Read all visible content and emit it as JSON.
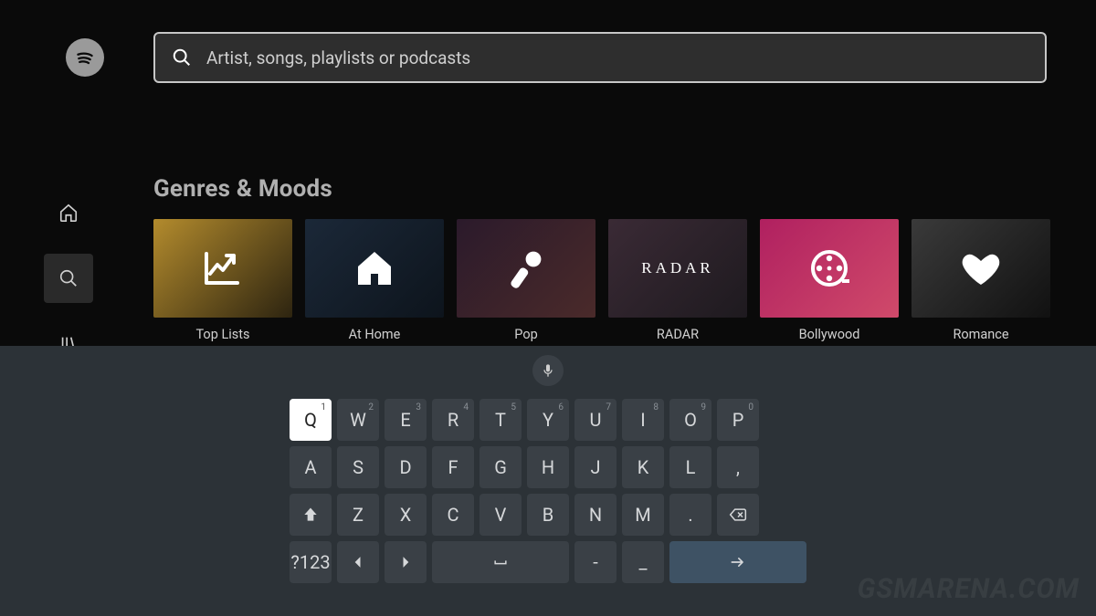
{
  "search": {
    "placeholder": "Artist, songs, playlists or podcasts"
  },
  "section_title": "Genres & Moods",
  "tiles": [
    {
      "label": "Top Lists",
      "icon": "chart-up-icon"
    },
    {
      "label": "At Home",
      "icon": "home-icon"
    },
    {
      "label": "Pop",
      "icon": "microphone-icon"
    },
    {
      "label": "RADAR",
      "icon": "radar-text",
      "overlay": "RADAR"
    },
    {
      "label": "Bollywood",
      "icon": "film-reel-icon"
    },
    {
      "label": "Romance",
      "icon": "heart-icon"
    }
  ],
  "keyboard": {
    "row1": [
      {
        "k": "Q",
        "sup": "1",
        "sel": true
      },
      {
        "k": "W",
        "sup": "2"
      },
      {
        "k": "E",
        "sup": "3"
      },
      {
        "k": "R",
        "sup": "4"
      },
      {
        "k": "T",
        "sup": "5"
      },
      {
        "k": "Y",
        "sup": "6"
      },
      {
        "k": "U",
        "sup": "7"
      },
      {
        "k": "I",
        "sup": "8"
      },
      {
        "k": "O",
        "sup": "9"
      },
      {
        "k": "P",
        "sup": "0"
      }
    ],
    "row2": [
      {
        "k": "A"
      },
      {
        "k": "S"
      },
      {
        "k": "D"
      },
      {
        "k": "F"
      },
      {
        "k": "G"
      },
      {
        "k": "H"
      },
      {
        "k": "J"
      },
      {
        "k": "K"
      },
      {
        "k": "L"
      },
      {
        "k": ","
      }
    ],
    "row3_letters": [
      {
        "k": "Z"
      },
      {
        "k": "X"
      },
      {
        "k": "C"
      },
      {
        "k": "V"
      },
      {
        "k": "B"
      },
      {
        "k": "N"
      },
      {
        "k": "M"
      },
      {
        "k": "."
      }
    ],
    "numkey_label": "?123",
    "dash": "-",
    "underscore": "_"
  },
  "watermark": "GSMARENA.COM"
}
